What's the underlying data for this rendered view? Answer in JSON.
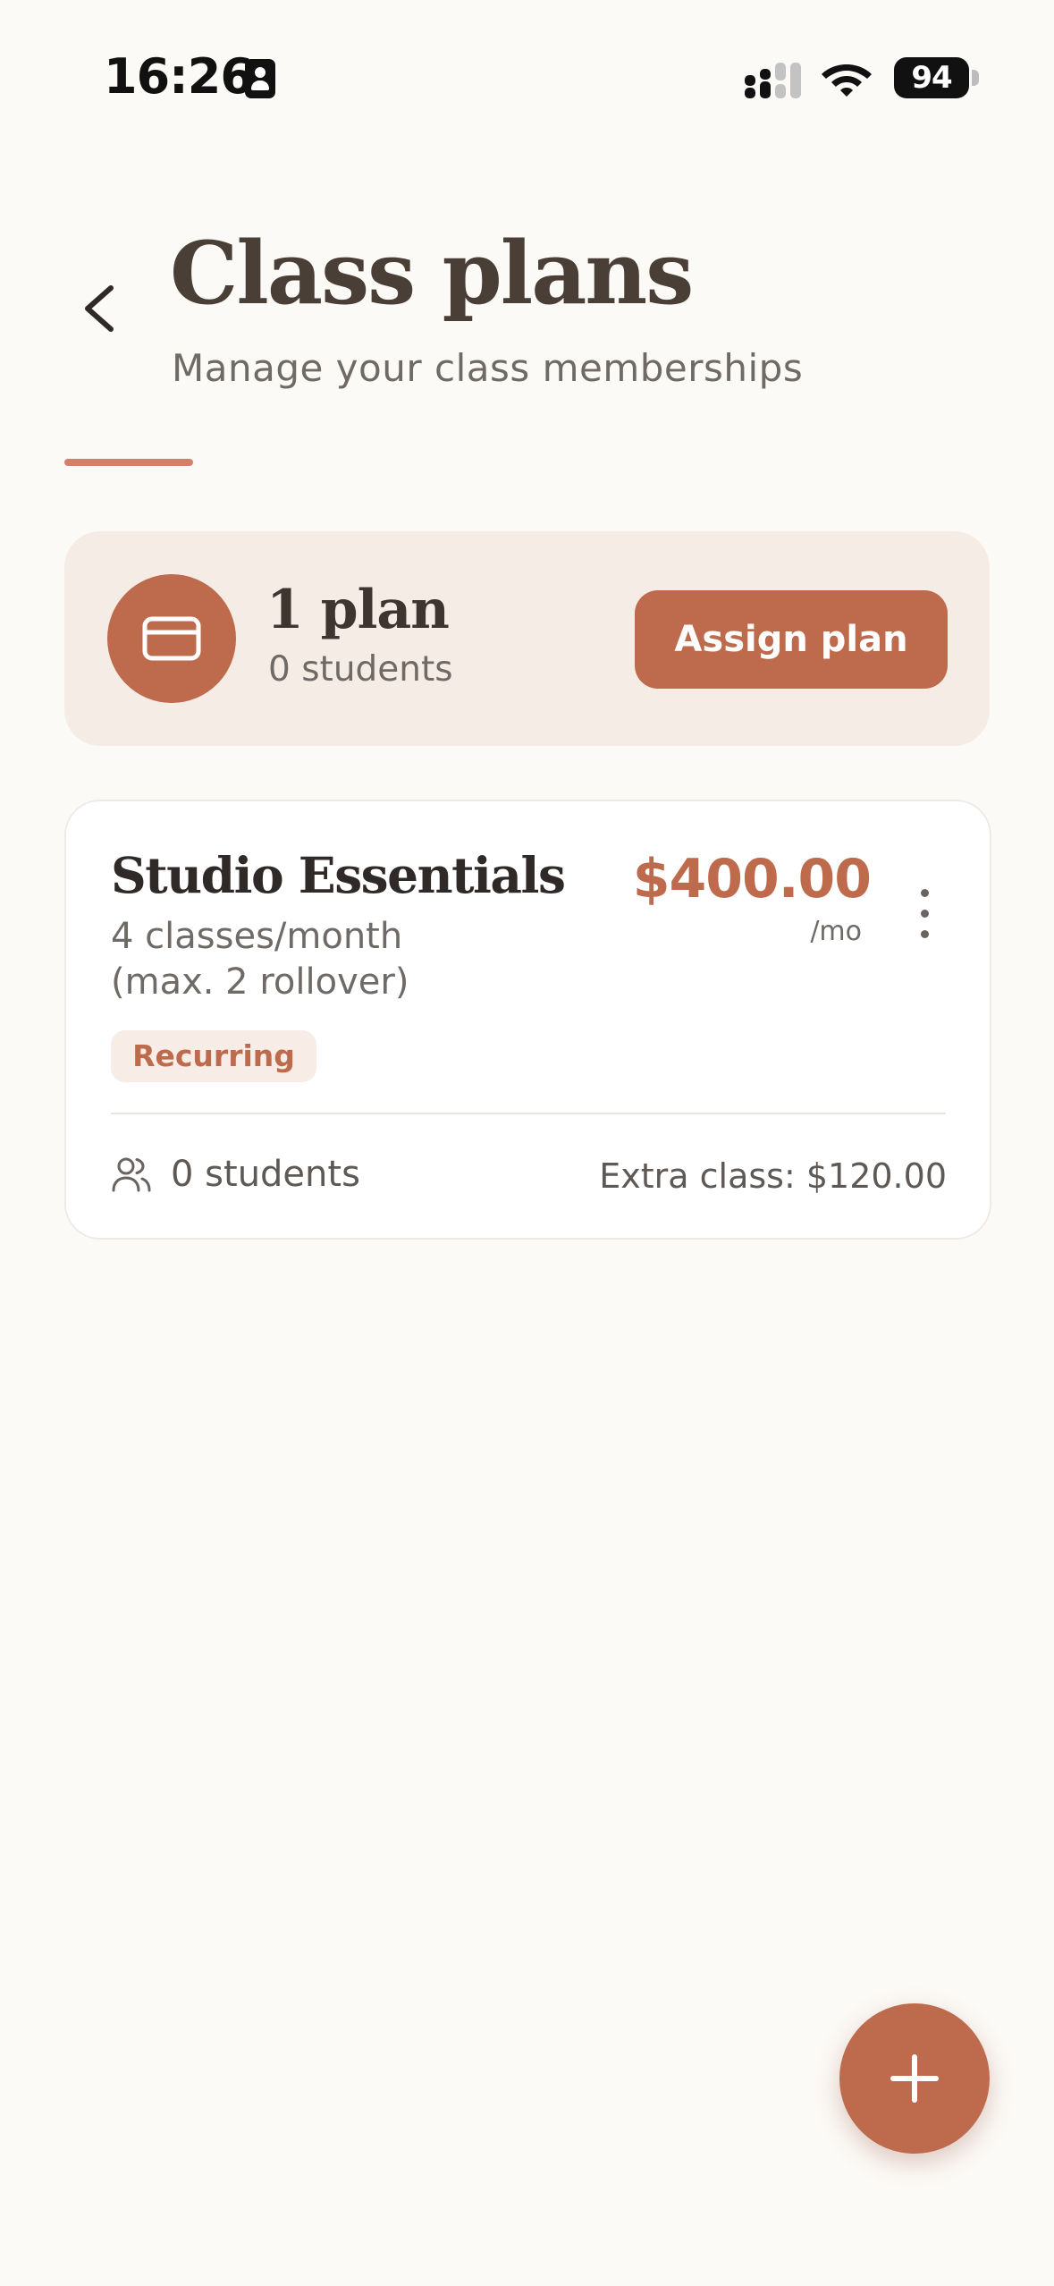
{
  "status_bar": {
    "time": "16:26",
    "battery_level": "94"
  },
  "header": {
    "title": "Class plans",
    "subtitle": "Manage your class memberships"
  },
  "summary": {
    "plan_count": "1 plan",
    "student_count": "0 students",
    "assign_label": "Assign plan"
  },
  "plans": [
    {
      "name": "Studio Essentials",
      "description": "4 classes/month (max. 2 rollover)",
      "type_badge": "Recurring",
      "price": "$400.00",
      "period": "/mo",
      "students": "0 students",
      "extra_class": "Extra class: $120.00"
    }
  ],
  "colors": {
    "accent": "#BE6B4D",
    "accent_light": "#D3826A",
    "summary_bg": "#F6ECE6",
    "page_bg": "#FCFAF6"
  },
  "icons": {
    "back": "chevron-left-icon",
    "summary": "credit-card-icon",
    "students": "users-icon",
    "menu": "more-vertical-icon",
    "fab": "plus-icon"
  }
}
